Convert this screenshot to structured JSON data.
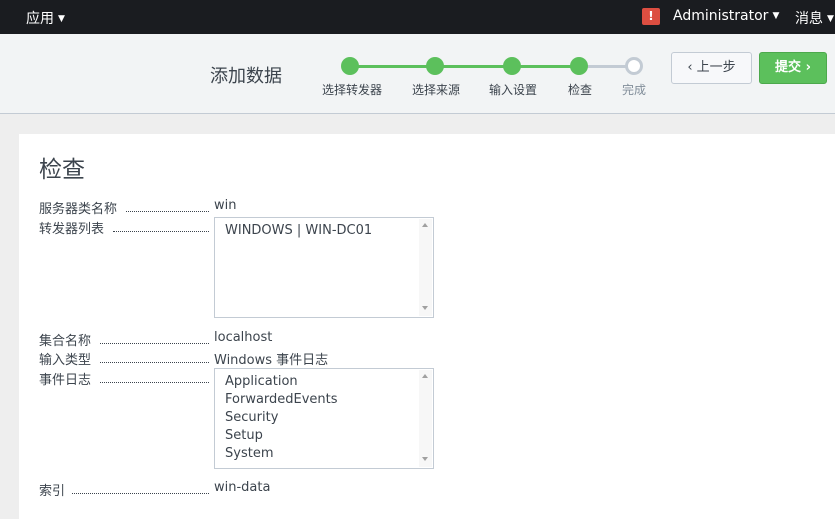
{
  "topbar": {
    "apps_label": "应用",
    "alert_glyph": "!",
    "user_label": "Administrator",
    "messages_label": "消息"
  },
  "wizard": {
    "title": "添加数据",
    "steps": [
      {
        "label": "选择转发器",
        "status": "done"
      },
      {
        "label": "选择来源",
        "status": "done"
      },
      {
        "label": "输入设置",
        "status": "done"
      },
      {
        "label": "检查",
        "status": "current"
      },
      {
        "label": "完成",
        "status": "todo"
      }
    ],
    "back_label": "上一步",
    "submit_label": "提交"
  },
  "review": {
    "heading": "检查",
    "server_class": {
      "label": "服务器类名称",
      "value": "win"
    },
    "forwarders": {
      "label": "转发器列表",
      "items": [
        "WINDOWS | WIN-DC01"
      ]
    },
    "collection": {
      "label": "集合名称",
      "value": "localhost"
    },
    "input_type": {
      "label": "输入类型",
      "value": "Windows 事件日志"
    },
    "event_logs": {
      "label": "事件日志",
      "items": [
        "Application",
        "ForwardedEvents",
        "Security",
        "Setup",
        "System"
      ]
    },
    "index": {
      "label": "索引",
      "value": "win-data"
    }
  },
  "colors": {
    "accent_green": "#5cc05c",
    "topbar_bg": "#1a1c20",
    "alert_red": "#dc4e41"
  }
}
